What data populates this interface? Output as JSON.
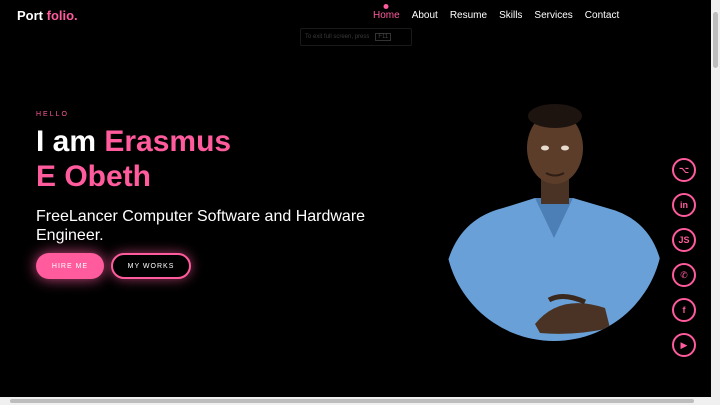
{
  "logo": {
    "part1": "Port",
    "part2": " folio."
  },
  "nav": {
    "items": [
      {
        "label": "Home"
      },
      {
        "label": "About"
      },
      {
        "label": "Resume"
      },
      {
        "label": "Skills"
      },
      {
        "label": "Services"
      },
      {
        "label": "Contact"
      }
    ]
  },
  "toast": {
    "text": "To exit full screen, press",
    "key": "F11"
  },
  "hero": {
    "hello": "HELLO",
    "intro": "I am",
    "name_line1": "Erasmus",
    "name_line2": "E Obeth",
    "tagline": "FreeLancer Computer Software and Hardware Engineer.",
    "hire_button": "HIRE ME",
    "works_button": "MY WORKS"
  },
  "socials": [
    {
      "icon": "github-icon",
      "glyph": "⌥"
    },
    {
      "icon": "linkedin-icon",
      "glyph": "in"
    },
    {
      "icon": "javascript-icon",
      "glyph": "JS"
    },
    {
      "icon": "whatsapp-icon",
      "glyph": "✆"
    },
    {
      "icon": "facebook-icon",
      "glyph": "f"
    },
    {
      "icon": "youtube-icon",
      "glyph": "▶"
    }
  ],
  "colors": {
    "accent": "#ff5b9d",
    "background": "#000000",
    "shirt": "#6aa0d8"
  }
}
